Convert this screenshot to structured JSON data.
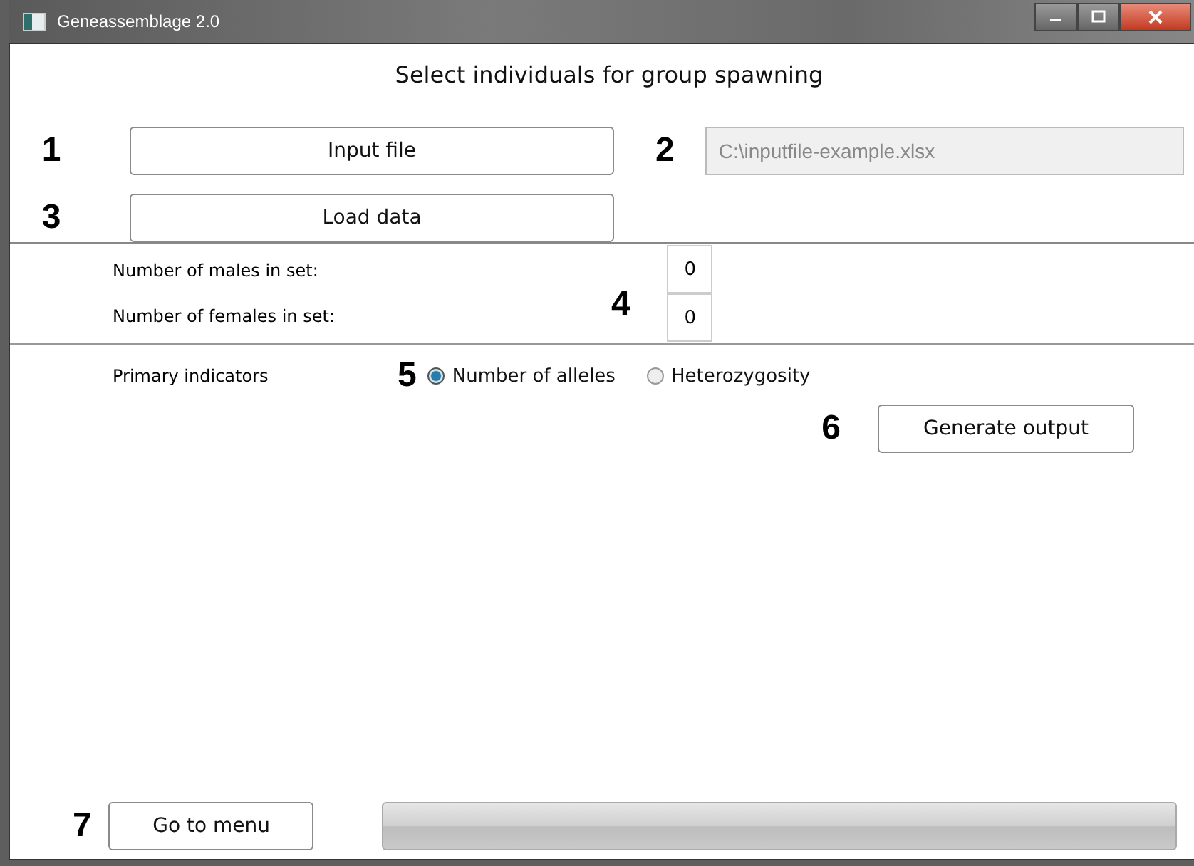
{
  "window": {
    "title": "Geneassemblage 2.0"
  },
  "heading": "Select individuals for group spawning",
  "input_file": {
    "marker": "1",
    "button": "Input file"
  },
  "path_field": {
    "marker": "2",
    "value": "C:\\inputfile-example.xlsx",
    "disabled": true
  },
  "load_data": {
    "marker": "3",
    "button": "Load data"
  },
  "counts": {
    "marker": "4",
    "rows": [
      {
        "label": "Number of males in set:",
        "value": "0"
      },
      {
        "label": "Number of females in set:",
        "value": "0"
      }
    ]
  },
  "indicators": {
    "label": "Primary indicators",
    "marker": "5",
    "options": [
      {
        "label": "Number of alleles",
        "selected": true
      },
      {
        "label": "Heterozygosity",
        "selected": false
      }
    ]
  },
  "generate": {
    "marker": "6",
    "button": "Generate output"
  },
  "menu": {
    "marker": "7",
    "button": "Go to menu"
  },
  "progress": {
    "level": 0
  }
}
